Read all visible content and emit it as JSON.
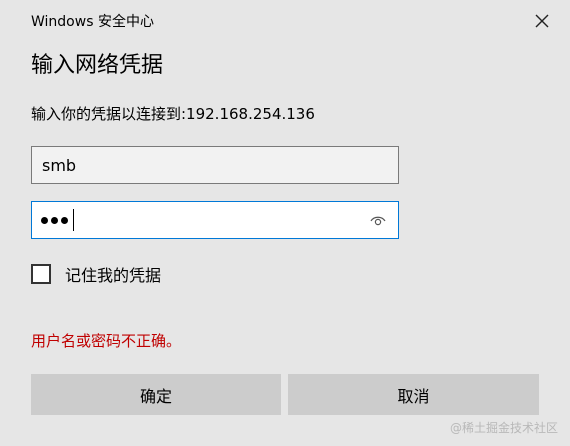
{
  "window": {
    "title": "Windows 安全中心"
  },
  "dialog": {
    "heading": "输入网络凭据",
    "prompt": "输入你的凭据以连接到:192.168.254.136"
  },
  "username": {
    "value": "smb"
  },
  "password": {
    "masked_length": 3,
    "reveal_icon": "eye-icon"
  },
  "remember": {
    "label": "记住我的凭据",
    "checked": false
  },
  "error": {
    "message": "用户名或密码不正确。",
    "color": "#c00000"
  },
  "buttons": {
    "ok_label": "确定",
    "cancel_label": "取消"
  },
  "watermark": {
    "text": "@稀土掘金技术社区"
  },
  "colors": {
    "focus_border": "#0078d7",
    "button_bg": "#cccccc",
    "dialog_bg": "#e6e6e6"
  }
}
